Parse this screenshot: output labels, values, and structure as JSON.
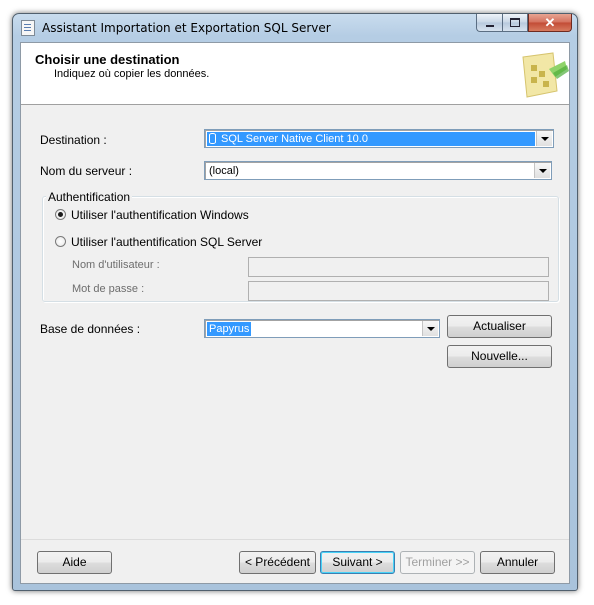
{
  "window": {
    "title": "Assistant Importation et Exportation SQL Server",
    "controls": {
      "minimize_icon": "minimize-icon",
      "maximize_icon": "maximize-icon",
      "close_glyph": "✕"
    }
  },
  "header": {
    "title": "Choisir une destination",
    "subtitle": "Indiquez où copier les données."
  },
  "form": {
    "destination_label": "Destination :",
    "destination_value": "SQL Server Native Client 10.0",
    "server_label": "Nom du serveur :",
    "server_value": "(local)",
    "auth_group_label": "Authentification",
    "auth_windows_label": "Utiliser l'authentification Windows",
    "auth_sql_label": "Utiliser l'authentification SQL Server",
    "auth_selected": "windows",
    "username_label": "Nom d'utilisateur :",
    "username_value": "",
    "password_label": "Mot de passe :",
    "password_value": "",
    "database_label": "Base de données :",
    "database_value": "Papyrus",
    "refresh_button": "Actualiser",
    "new_button": "Nouvelle..."
  },
  "footer": {
    "help": "Aide",
    "previous": "< Précédent",
    "next": "Suivant >",
    "finish": "Terminer >>",
    "cancel": "Annuler"
  },
  "colors": {
    "selection": "#3399ff",
    "window_frame": "#b5cde4",
    "close_button": "#c24b35"
  }
}
